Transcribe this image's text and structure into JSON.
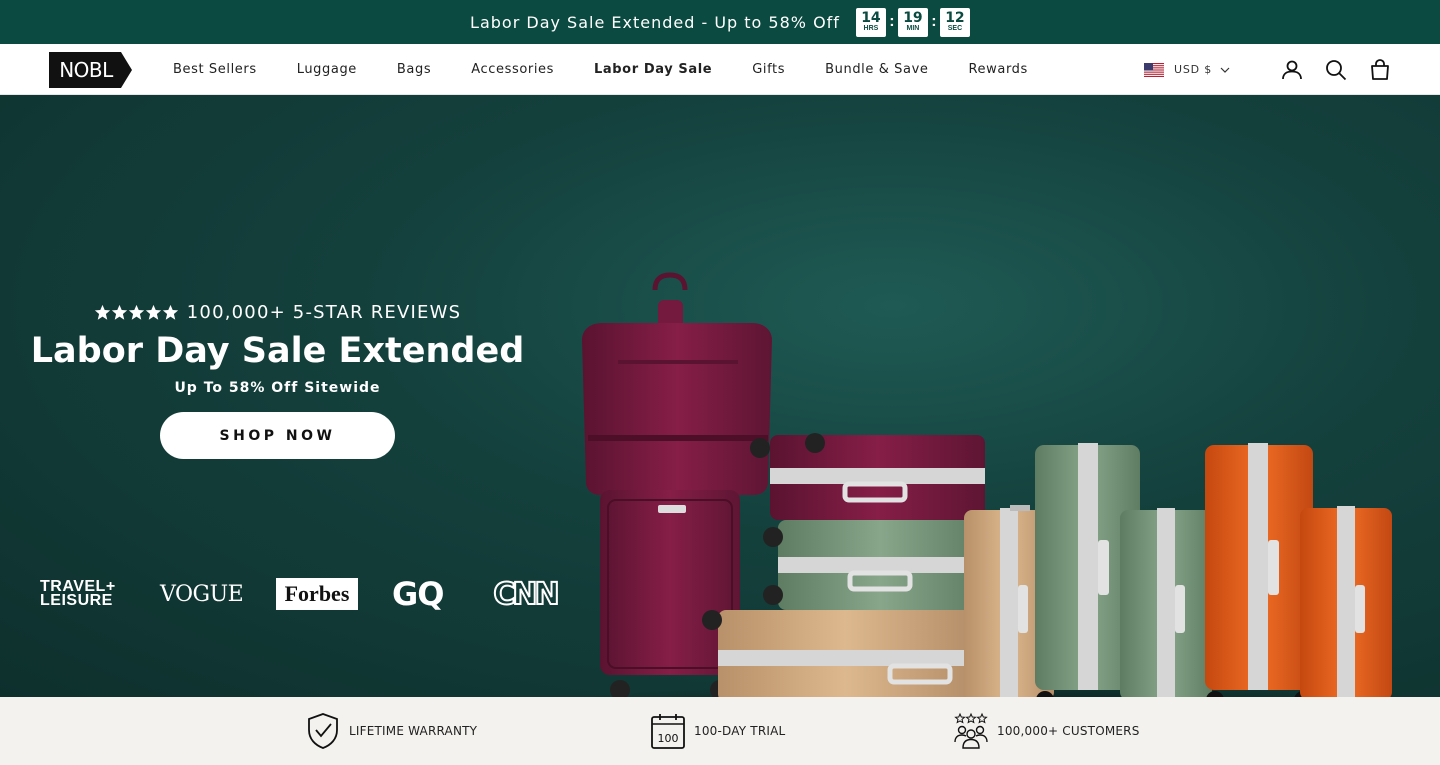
{
  "announcement": {
    "text": "Labor Day Sale Extended - Up to 58% Off",
    "timer": [
      {
        "value": "14",
        "unit": "HRS"
      },
      {
        "value": "19",
        "unit": "MIN"
      },
      {
        "value": "12",
        "unit": "SEC"
      }
    ],
    "separator": ":"
  },
  "header": {
    "logo": "NOBL",
    "nav": [
      "Best Sellers",
      "Luggage",
      "Bags",
      "Accessories",
      "Labor Day Sale",
      "Gifts",
      "Bundle & Save",
      "Rewards"
    ],
    "active_nav": "Labor Day Sale",
    "currency": "USD $"
  },
  "hero": {
    "reviews": "100,000+ 5-STAR REVIEWS",
    "star_rating": 5,
    "title": "Labor Day Sale Extended",
    "subtitle": "Up To 58% Off Sitewide",
    "cta": "SHOP NOW",
    "press": {
      "travel_leisure_line1": "TRAVEL+",
      "travel_leisure_line2": "LEISURE",
      "vogue": "VOGUE",
      "forbes": "Forbes",
      "gq": "GQ",
      "cnn": "CNN"
    }
  },
  "trust": [
    {
      "icon": "shield-check-icon",
      "label": "LIFETIME WARRANTY"
    },
    {
      "icon": "calendar-100-icon",
      "label": "100-DAY TRIAL",
      "icon_text": "100"
    },
    {
      "icon": "customers-icon",
      "label": "100,000+ CUSTOMERS"
    }
  ],
  "colors": {
    "brand_green": "#0b4a40",
    "hero_bg": "#14413d",
    "trust_bg": "#f4f2ee"
  }
}
